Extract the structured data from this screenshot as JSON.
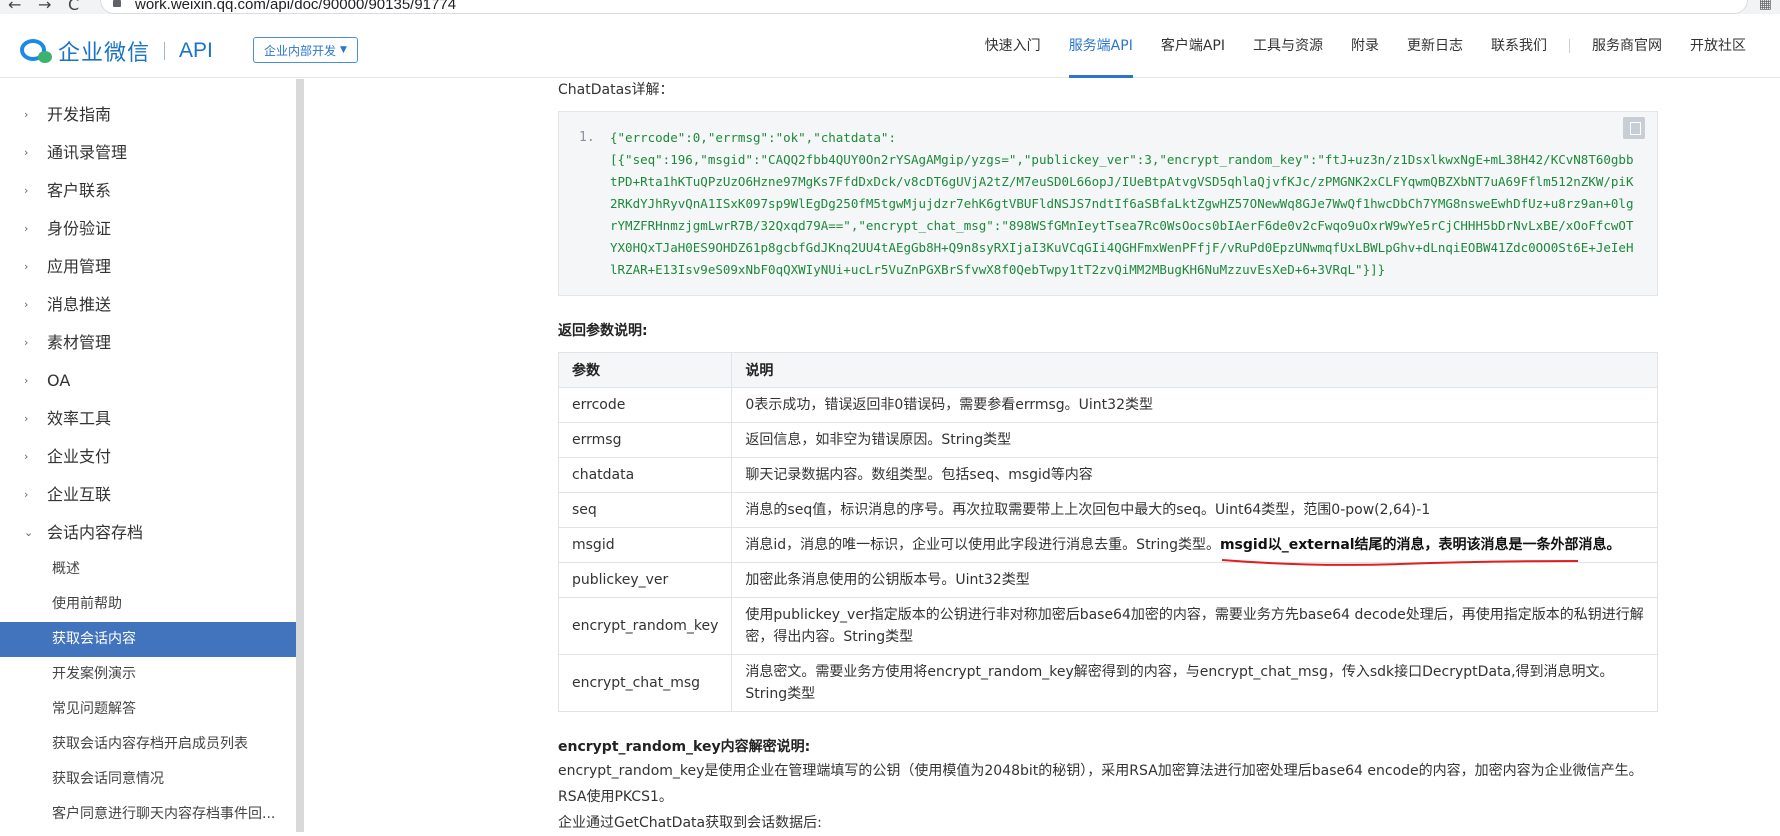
{
  "browser": {
    "url": "work.weixin.qq.com/api/doc/90000/90135/91774",
    "back_glyph": "←",
    "forward_glyph": "→",
    "reload_glyph": "C"
  },
  "header": {
    "logo_text": "企业微信",
    "logo_api": "API",
    "scope_button": "企业内部开发",
    "nav": [
      "快速入门",
      "服务端API",
      "客户端API",
      "工具与资源",
      "附录",
      "更新日志",
      "联系我们",
      "服务商官网",
      "开放社区"
    ],
    "active_nav": "服务端API"
  },
  "sidebar": {
    "items": [
      {
        "label": "开发指南",
        "expanded": false
      },
      {
        "label": "通讯录管理",
        "expanded": false
      },
      {
        "label": "客户联系",
        "expanded": false
      },
      {
        "label": "身份验证",
        "expanded": false
      },
      {
        "label": "应用管理",
        "expanded": false
      },
      {
        "label": "消息推送",
        "expanded": false
      },
      {
        "label": "素材管理",
        "expanded": false
      },
      {
        "label": "OA",
        "expanded": false
      },
      {
        "label": "效率工具",
        "expanded": false
      },
      {
        "label": "企业支付",
        "expanded": false
      },
      {
        "label": "企业互联",
        "expanded": false
      },
      {
        "label": "会话内容存档",
        "expanded": true
      }
    ],
    "subitems": [
      "概述",
      "使用前帮助",
      "获取会话内容",
      "开发案例演示",
      "常见问题解答",
      "获取会话内容存档开启成员列表",
      "获取会话同意情况",
      "客户同意进行聊天内容存档事件回..."
    ],
    "active_subitem": "获取会话内容"
  },
  "main": {
    "chatdatas_label": "ChatDatas详解：",
    "code_line_no": "1.",
    "code": "{\"errcode\":0,\"errmsg\":\"ok\",\"chatdata\":\n[{\"seq\":196,\"msgid\":\"CAQQ2fbb4QUY0On2rYSAgAMgip/yzgs=\",\"publickey_ver\":3,\"encrypt_random_key\":\"ftJ+uz3n/z1DsxlkwxNgE+mL38H42/KCvN8T60gbbtPD+Rta1hKTuQPzUzO6Hzne97MgKs7FfdDxDck/v8cDT6gUVjA2tZ/M7euSD0L66opJ/IUeBtpAtvgVSD5qhlaQjvfKJc/zPMGNK2xCLFYqwmQBZXbNT7uA69Fflm512nZKW/piK2RKdYJhRyvQnA1ISxK097sp9WlEgDg250fM5tgwMjujdzr7ehK6gtVBUFldNSJS7ndtIf6aSBfaLktZgwHZ57ONewWq8GJe7WwQf1hwcDbCh7YMG8nsweEwhDfUz+u8rz9an+0lgrYMZFRHnmzjgmLwrR7B/32Qxqd79A==\",\"encrypt_chat_msg\":\"898WSfGMnIeytTsea7Rc0WsOocs0bIAerF6de0v2cFwqo9uOxrW9wYe5rCjCHHH5bDrNvLxBE/xOoFfcwOTYX0HQxTJaH0ES9OHDZ61p8gcbfGdJKnq2UU4tAEgGb8H+Q9n8syRXIjaI3KuVCqGIi4QGHFmxWenPFfjF/vRuPd0EpzUNwmqfUxLBWLpGhv+dLnqiEOBW41Zdc0OO0St6E+JeIeHlRZAR+E13Isv9eS09xNbF0qQXWIyNUi+ucLr5VuZnPGXBrSfvwX8f0QebTwpy1tT2zvQiMM2MBugKH6NuMzzuvEsXeD+6+3VRqL\"}]}",
    "return_title": "返回参数说明:",
    "table": {
      "headers": [
        "参数",
        "说明"
      ],
      "rows": [
        {
          "param": "errcode",
          "desc": "0表示成功，错误返回非0错误码，需要参看errmsg。Uint32类型",
          "strong": ""
        },
        {
          "param": "errmsg",
          "desc": "返回信息，如非空为错误原因。String类型",
          "strong": ""
        },
        {
          "param": "chatdata",
          "desc": "聊天记录数据内容。数组类型。包括seq、msgid等内容",
          "strong": ""
        },
        {
          "param": "seq",
          "desc": "消息的seq值，标识消息的序号。再次拉取需要带上上次回包中最大的seq。Uint64类型，范围0-pow(2,64)-1",
          "strong": ""
        },
        {
          "param": "msgid",
          "desc": "消息id，消息的唯一标识，企业可以使用此字段进行消息去重。String类型。",
          "strong": "msgid以_external结尾的消息，表明该消息是一条外部消息。"
        },
        {
          "param": "publickey_ver",
          "desc": "加密此条消息使用的公钥版本号。Uint32类型",
          "strong": ""
        },
        {
          "param": "encrypt_random_key",
          "desc": "使用publickey_ver指定版本的公钥进行非对称加密后base64加密的内容，需要业务方先base64 decode处理后，再使用指定版本的私钥进行解密，得出内容。String类型",
          "strong": ""
        },
        {
          "param": "encrypt_chat_msg",
          "desc": "消息密文。需要业务方使用将encrypt_random_key解密得到的内容，与encrypt_chat_msg，传入sdk接口DecryptData,得到消息明文。String类型",
          "strong": ""
        }
      ]
    },
    "decrypt_title": "encrypt_random_key内容解密说明:",
    "decrypt_para1": "encrypt_random_key是使用企业在管理端填写的公钥（使用模值为2048bit的秘钥），采用RSA加密算法进行加密处理后base64 encode的内容，加密内容为企业微信产生。RSA使用PKCS1。",
    "decrypt_para2": "企业通过GetChatData获取到会话数据后:"
  }
}
